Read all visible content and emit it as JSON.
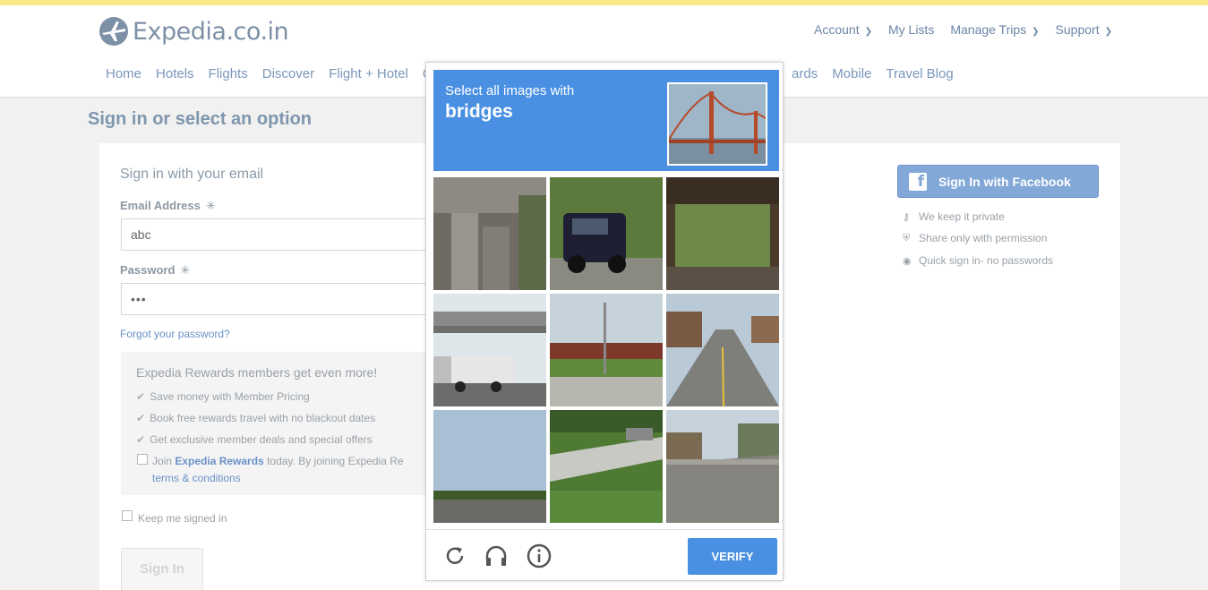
{
  "brand": {
    "logo_text": "Expedia.co.in"
  },
  "account_nav": [
    {
      "label": "Account",
      "dropdown": true
    },
    {
      "label": "My Lists",
      "dropdown": false
    },
    {
      "label": "Manage Trips",
      "dropdown": true
    },
    {
      "label": "Support",
      "dropdown": true
    }
  ],
  "main_nav_left": [
    "Home",
    "Hotels",
    "Flights",
    "Discover",
    "Flight + Hotel",
    "C"
  ],
  "main_nav_right": [
    "ards",
    "Mobile",
    "Travel Blog"
  ],
  "page": {
    "title": "Sign in or select an option"
  },
  "signin": {
    "heading": "Sign in with your email",
    "email_label": "Email Address",
    "email_value": "abc",
    "password_label": "Password",
    "password_value": "•••",
    "required_mark": "✳",
    "forgot": "Forgot your password?",
    "button": "Sign In"
  },
  "rewards": {
    "title": "Expedia Rewards members get even more!",
    "bullets": [
      "Save money with Member Pricing",
      "Book free rewards travel with no blackout dates",
      "Get exclusive member deals and special offers"
    ],
    "join_prefix": "Join ",
    "join_brand": "Expedia Rewards",
    "join_suffix": " today. By joining Expedia Re",
    "terms": "terms & conditions"
  },
  "keep_signed_in": "Keep me signed in",
  "facebook": {
    "button": "Sign In with Facebook",
    "perks": [
      "We keep it private",
      "Share only with permission",
      "Quick sign in- no passwords"
    ]
  },
  "captcha": {
    "line1": "Select all images with",
    "line2": "bridges",
    "verify": "VERIFY",
    "accent": "#4a90e2"
  }
}
